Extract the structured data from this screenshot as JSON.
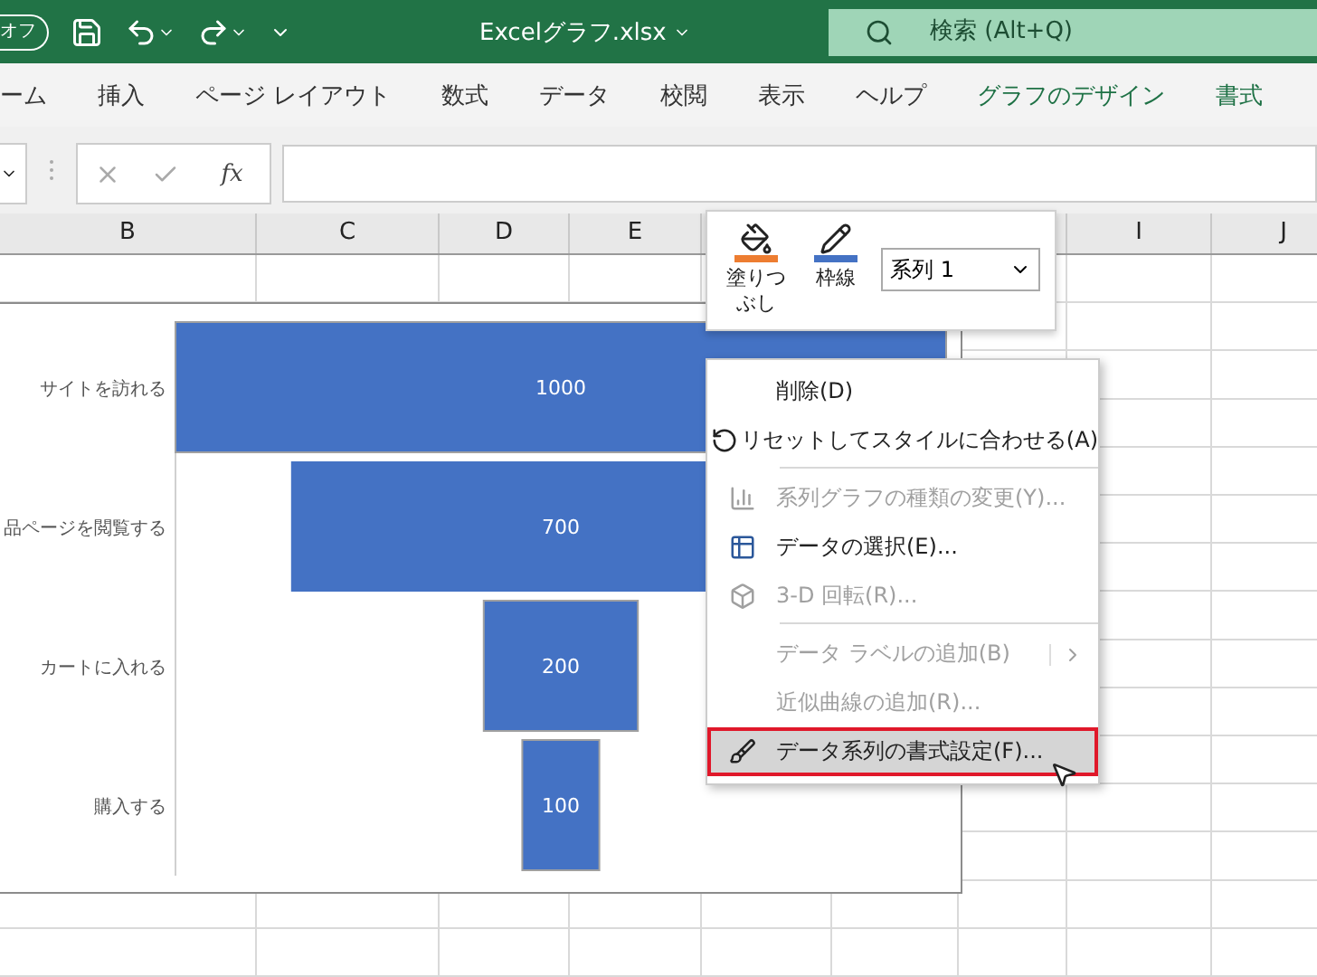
{
  "title_bar": {
    "autosave": "オフ",
    "filename": "Excelグラフ.xlsx",
    "search_placeholder": "検索 (Alt+Q)"
  },
  "ribbon_tabs": [
    {
      "label": "ーム",
      "contextual": false
    },
    {
      "label": "挿入",
      "contextual": false
    },
    {
      "label": "ページ レイアウト",
      "contextual": false
    },
    {
      "label": "数式",
      "contextual": false
    },
    {
      "label": "データ",
      "contextual": false
    },
    {
      "label": "校閲",
      "contextual": false
    },
    {
      "label": "表示",
      "contextual": false
    },
    {
      "label": "ヘルプ",
      "contextual": false
    },
    {
      "label": "グラフのデザイン",
      "contextual": true
    },
    {
      "label": "書式",
      "contextual": true
    }
  ],
  "formula_bar": {
    "function_button": "fx"
  },
  "columns": [
    {
      "label": "B"
    },
    {
      "label": "C"
    },
    {
      "label": "D"
    },
    {
      "label": "E"
    },
    {
      "label": "I"
    },
    {
      "label": "J"
    }
  ],
  "funnel_chart": {
    "stages": [
      {
        "label": "サイトを訪れる",
        "value": "1000"
      },
      {
        "label": "品ページを閲覧する",
        "value": "700"
      },
      {
        "label": "カートに入れる",
        "value": "200"
      },
      {
        "label": "購入する",
        "value": "100"
      }
    ]
  },
  "mini_toolbar": {
    "fill_label": "塗りつぶし",
    "outline_label": "枠線",
    "series_select": "系列 1"
  },
  "context_menu": [
    {
      "label": "削除(D)",
      "disabled": false,
      "highlighted": false,
      "submenu": false,
      "separator_before": false
    },
    {
      "label": "リセットしてスタイルに合わせる(A)",
      "disabled": false,
      "highlighted": false,
      "submenu": false,
      "separator_before": false
    },
    {
      "label": "系列グラフの種類の変更(Y)...",
      "disabled": true,
      "highlighted": false,
      "submenu": false,
      "separator_before": true
    },
    {
      "label": "データの選択(E)...",
      "disabled": false,
      "highlighted": false,
      "submenu": false,
      "separator_before": false
    },
    {
      "label": "3-D 回転(R)...",
      "disabled": true,
      "highlighted": false,
      "submenu": false,
      "separator_before": false
    },
    {
      "label": "データ ラベルの追加(B)",
      "disabled": true,
      "highlighted": false,
      "submenu": true,
      "separator_before": true
    },
    {
      "label": "近似曲線の追加(R)...",
      "disabled": true,
      "highlighted": false,
      "submenu": false,
      "separator_before": false
    },
    {
      "label": "データ系列の書式設定(F)...",
      "disabled": false,
      "highlighted": true,
      "submenu": false,
      "separator_before": false
    }
  ]
}
